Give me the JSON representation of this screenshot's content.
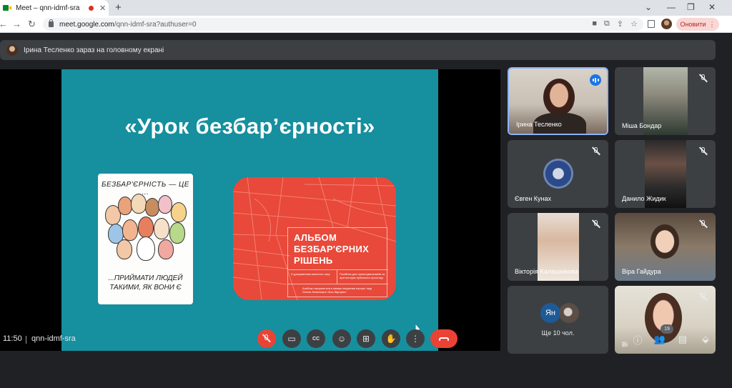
{
  "browser": {
    "tab_title": "Meet – qnn-idmf-sra",
    "tab_close": "✕",
    "new_tab": "+",
    "url_host": "meet.google.com",
    "url_path": "/qnn-idmf-sra?authuser=0",
    "update_label": "Оновити",
    "window_controls": [
      "⌄",
      "—",
      "❐",
      "✕"
    ]
  },
  "banner": {
    "text": "Ірина Тесленко зараз на головному екрані"
  },
  "slide": {
    "title": "«Урок  безбар’єрності»",
    "poster_top": "БЕЗБАР'ЄРНІСТЬ — ЦЕ ...",
    "poster_bottom_1": "...ПРИЙМАТИ ЛЮДЕЙ",
    "poster_bottom_2": "ТАКИМИ, ЯК ВОНИ Є",
    "album_title_1": "АЛЬБОМ",
    "album_title_2": "БЕЗБАР'ЄРНИХ",
    "album_title_3": "РІШЕНЬ",
    "album_col_1": "З урахуванням воєнного часу",
    "album_col_2": "Посібник для проектувальників та архітекторів публічного простору",
    "album_footer": "Альбом створюється в межах ініціативи першої леді Олени Зеленської «Без бар'єрів»"
  },
  "participants": [
    {
      "name": "Ірина Тесленко",
      "state": "speaking"
    },
    {
      "name": "Міша Бондар",
      "state": "muted"
    },
    {
      "name": "Євген Кунах",
      "state": "muted"
    },
    {
      "name": "Данило Жидик",
      "state": "muted"
    },
    {
      "name": "Вікторія Калашнікова",
      "state": "muted"
    },
    {
      "name": "Віра Гайдура",
      "state": "muted"
    },
    {
      "name": "Ще 10 чол.",
      "initials": "Ян"
    },
    {
      "name": "Ві",
      "state": "muted"
    }
  ],
  "bottom": {
    "time": "11:50",
    "meeting_code": "qnn-idmf-sra",
    "participant_count": "19"
  },
  "colors": {
    "slide_bg": "#168f9e",
    "album_bg": "#e8493a",
    "hangup": "#ea4335",
    "active_border": "#8ab4f8",
    "speaking": "#1a73e8"
  }
}
